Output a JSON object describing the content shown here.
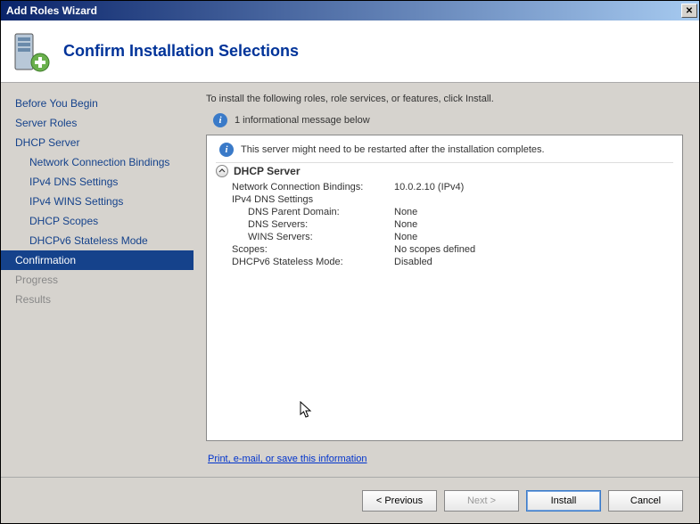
{
  "window": {
    "title": "Add Roles Wizard"
  },
  "header": {
    "title": "Confirm Installation Selections"
  },
  "sidebar": {
    "items": [
      {
        "label": "Before You Begin",
        "class": ""
      },
      {
        "label": "Server Roles",
        "class": ""
      },
      {
        "label": "DHCP Server",
        "class": ""
      },
      {
        "label": "Network Connection Bindings",
        "class": "child"
      },
      {
        "label": "IPv4 DNS Settings",
        "class": "child"
      },
      {
        "label": "IPv4 WINS Settings",
        "class": "child"
      },
      {
        "label": "DHCP Scopes",
        "class": "child"
      },
      {
        "label": "DHCPv6 Stateless Mode",
        "class": "child"
      },
      {
        "label": "Confirmation",
        "class": "selected"
      },
      {
        "label": "Progress",
        "class": "disabled"
      },
      {
        "label": "Results",
        "class": "disabled"
      }
    ]
  },
  "main": {
    "intro": "To install the following roles, role services, or features, click Install.",
    "info_count_msg": "1 informational message below",
    "restart_msg": "This server might need to be restarted after the installation completes.",
    "section_title": "DHCP Server",
    "rows": [
      {
        "key": "Network Connection Bindings:",
        "val": "10.0.2.10 (IPv4)",
        "indent": 0
      },
      {
        "key": "IPv4 DNS Settings",
        "val": "",
        "indent": 0,
        "heading": true
      },
      {
        "key": "DNS Parent Domain:",
        "val": "None",
        "indent": 1
      },
      {
        "key": "DNS Servers:",
        "val": "None",
        "indent": 1
      },
      {
        "key": "WINS Servers:",
        "val": "None",
        "indent": 1
      },
      {
        "key": "Scopes:",
        "val": "No scopes defined",
        "indent": 0
      },
      {
        "key": "DHCPv6 Stateless Mode:",
        "val": "Disabled",
        "indent": 0
      }
    ],
    "link": "Print, e-mail, or save this information"
  },
  "footer": {
    "previous": "< Previous",
    "next": "Next >",
    "install": "Install",
    "cancel": "Cancel"
  }
}
